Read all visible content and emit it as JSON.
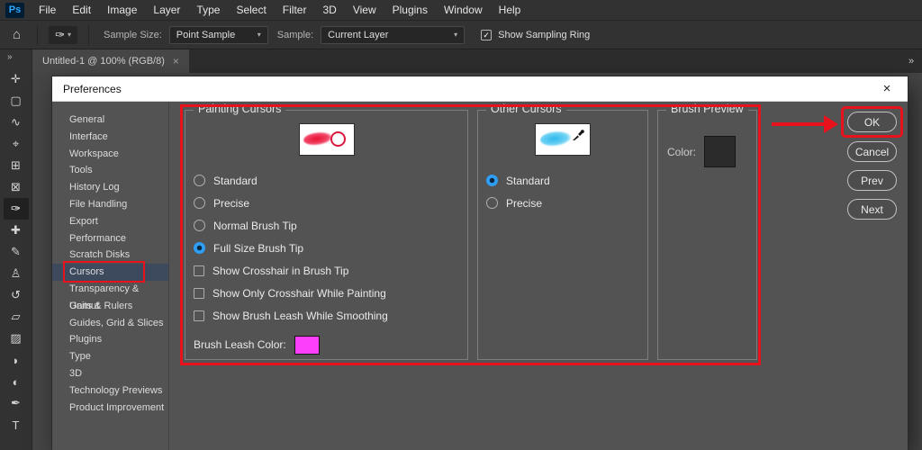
{
  "menubar": {
    "logo": "Ps",
    "items": [
      "File",
      "Edit",
      "Image",
      "Layer",
      "Type",
      "Select",
      "Filter",
      "3D",
      "View",
      "Plugins",
      "Window",
      "Help"
    ]
  },
  "optionsbar": {
    "home_icon": "⌂",
    "tool_icon": "✑",
    "chevron": "▾",
    "sample_size_label": "Sample Size:",
    "sample_size_value": "Point Sample",
    "sample_label": "Sample:",
    "sample_value": "Current Layer",
    "sampling_ring_label": "Show Sampling Ring",
    "sampling_ring_checked": true,
    "check_glyph": "✓"
  },
  "tabbar": {
    "tab_title": "Untitled-1 @ 100% (RGB/8)",
    "tab_close": "×",
    "panel_collapse": "»"
  },
  "toolbar": {
    "expand": "»",
    "tools": [
      {
        "name": "move",
        "glyph": "✛"
      },
      {
        "name": "rectangular-marquee",
        "glyph": "▢"
      },
      {
        "name": "lasso",
        "glyph": "∿"
      },
      {
        "name": "object-selection",
        "glyph": "⌖"
      },
      {
        "name": "crop",
        "glyph": "⊞"
      },
      {
        "name": "frame",
        "glyph": "⊠"
      },
      {
        "name": "eyedropper",
        "glyph": "✑",
        "active": true
      },
      {
        "name": "spot-healing",
        "glyph": "✚"
      },
      {
        "name": "brush",
        "glyph": "✎"
      },
      {
        "name": "clone-stamp",
        "glyph": "♙"
      },
      {
        "name": "history-brush",
        "glyph": "↺"
      },
      {
        "name": "eraser",
        "glyph": "▱"
      },
      {
        "name": "gradient",
        "glyph": "▨"
      },
      {
        "name": "blur",
        "glyph": "◗"
      },
      {
        "name": "dodge",
        "glyph": "◐"
      },
      {
        "name": "pen",
        "glyph": "✒"
      },
      {
        "name": "type",
        "glyph": "T"
      }
    ]
  },
  "dialog": {
    "title": "Preferences",
    "close": "×",
    "sidebar": {
      "items": [
        "General",
        "Interface",
        "Workspace",
        "Tools",
        "History Log",
        "File Handling",
        "Export",
        "Performance",
        "Scratch Disks",
        "Cursors",
        "Transparency & Gamut",
        "Units & Rulers",
        "Guides, Grid & Slices",
        "Plugins",
        "Type",
        "3D",
        "Technology Previews",
        "Product Improvement"
      ],
      "selected": "Cursors"
    },
    "painting_cursors": {
      "title": "Painting Cursors",
      "radios": [
        {
          "label": "Standard",
          "selected": false
        },
        {
          "label": "Precise",
          "selected": false
        },
        {
          "label": "Normal Brush Tip",
          "selected": false
        },
        {
          "label": "Full Size Brush Tip",
          "selected": true
        }
      ],
      "checkboxes": [
        {
          "label": "Show Crosshair in Brush Tip",
          "checked": false
        },
        {
          "label": "Show Only Crosshair While Painting",
          "checked": false
        },
        {
          "label": "Show Brush Leash While Smoothing",
          "checked": false
        }
      ],
      "leash_label": "Brush Leash Color:",
      "leash_color": "#fb3ffb"
    },
    "other_cursors": {
      "title": "Other Cursors",
      "radios": [
        {
          "label": "Standard",
          "selected": true
        },
        {
          "label": "Precise",
          "selected": false
        }
      ]
    },
    "brush_preview": {
      "title": "Brush Preview",
      "color_label": "Color:",
      "color_value": "#2b2b2b"
    },
    "buttons": {
      "ok": "OK",
      "cancel": "Cancel",
      "prev": "Prev",
      "next": "Next"
    }
  },
  "annotations": {
    "color": "#e8121d"
  }
}
